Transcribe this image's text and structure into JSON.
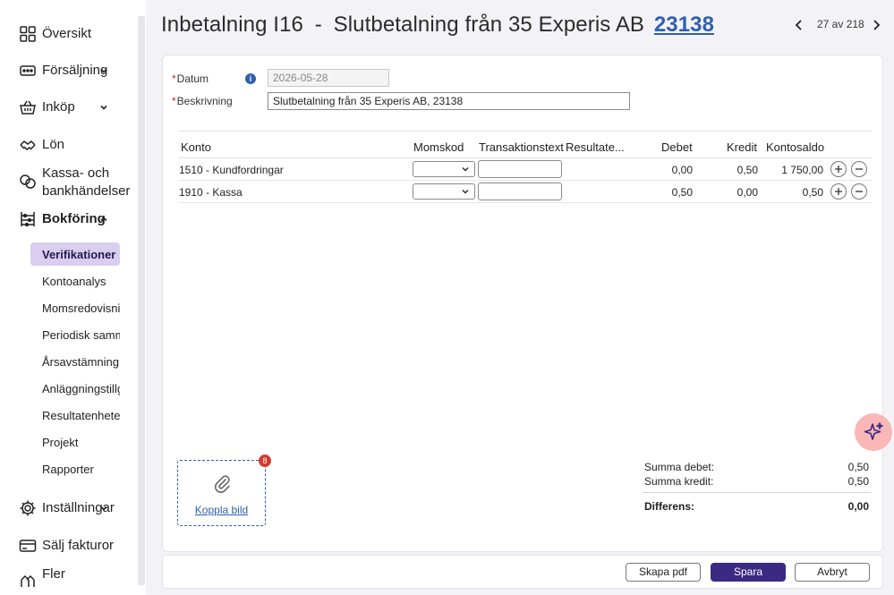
{
  "sidebar": {
    "items": [
      {
        "label": "Översikt",
        "icon": "grid-icon"
      },
      {
        "label": "Försäljning",
        "icon": "cash-register-icon"
      },
      {
        "label": "Inköp",
        "icon": "basket-icon"
      },
      {
        "label": "Lön",
        "icon": "handshake-icon"
      },
      {
        "label": "Kassa- och bankhändelser",
        "line1": "Kassa- och",
        "line2": "bankhändelser",
        "icon": "coins-icon"
      },
      {
        "label": "Bokföring",
        "icon": "abacus-icon"
      },
      {
        "label": "Inställningar",
        "icon": "gear-icon"
      },
      {
        "label": "Sälj fakturor",
        "icon": "card-icon"
      },
      {
        "label": "Fler",
        "icon": "more-icon"
      }
    ],
    "bokforing_sub": [
      {
        "label": "Verifikationer",
        "active": true
      },
      {
        "label": "Kontoanalys"
      },
      {
        "label": "Momsredovisning"
      },
      {
        "label": "Periodisk sammanställning"
      },
      {
        "label": "Årsavstämning"
      },
      {
        "label": "Anläggningstillgångar"
      },
      {
        "label": "Resultatenheter"
      },
      {
        "label": "Projekt"
      },
      {
        "label": "Rapporter"
      }
    ]
  },
  "header": {
    "prefix": "Inbetalning I16",
    "separator": "-",
    "description": "Slutbetalning från 35 Experis AB",
    "link_number": "23138"
  },
  "pager": {
    "text": "27 av 218"
  },
  "form": {
    "date_label": "Datum",
    "date_value": "2026-05-28",
    "desc_label": "Beskrivning",
    "desc_value": "Slutbetalning från 35 Experis AB, 23138"
  },
  "table": {
    "headers": {
      "konto": "Konto",
      "momskod": "Momskod",
      "transaktionstext": "Transaktionstext",
      "resultatenhet": "Resultate...",
      "debet": "Debet",
      "kredit": "Kredit",
      "kontosaldo": "Kontosaldo"
    },
    "rows": [
      {
        "konto": "1510 - Kundfordringar",
        "momskod": "",
        "transaktionstext": "",
        "debet": "0,00",
        "kredit": "0,50",
        "kontosaldo": "1 750,00"
      },
      {
        "konto": "1910 - Kassa",
        "momskod": "",
        "transaktionstext": "",
        "debet": "0,50",
        "kredit": "0,00",
        "kontosaldo": "0,50"
      }
    ]
  },
  "attachment": {
    "label": "Koppla bild",
    "badge": "8"
  },
  "summary": {
    "debet_label": "Summa debet:",
    "debet_value": "0,50",
    "kredit_label": "Summa kredit:",
    "kredit_value": "0,50",
    "diff_label": "Differens:",
    "diff_value": "0,00"
  },
  "footer": {
    "pdf_label": "Skapa pdf",
    "save_label": "Spara",
    "cancel_label": "Avbryt"
  },
  "colors": {
    "primary": "#3b2a84",
    "link": "#2f5fae",
    "active_sub_bg": "#d9cdf0",
    "ai_button": "#f9b7b6",
    "required": "#d02020"
  }
}
